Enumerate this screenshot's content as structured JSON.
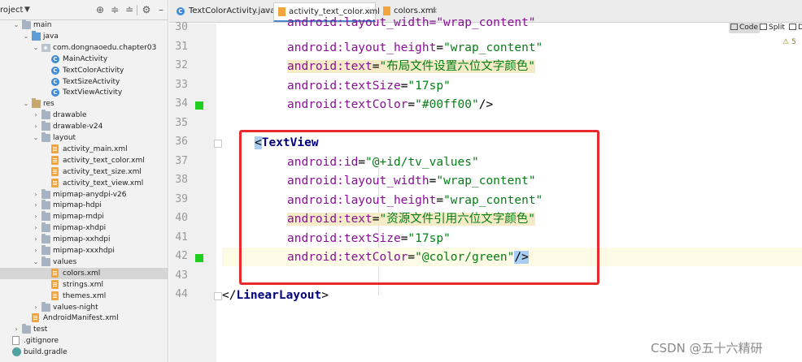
{
  "project": {
    "title": "roject",
    "tree": [
      {
        "label": "main",
        "icon": "folder",
        "expanded": true
      },
      {
        "label": "java",
        "icon": "java",
        "expanded": true
      },
      {
        "label": "com.dongnaoedu.chapter03",
        "icon": "package",
        "expanded": true
      },
      {
        "label": "MainActivity",
        "icon": "class"
      },
      {
        "label": "TextColorActivity",
        "icon": "class"
      },
      {
        "label": "TextSizeActivity",
        "icon": "class"
      },
      {
        "label": "TextViewActivity",
        "icon": "class"
      },
      {
        "label": "res",
        "icon": "res",
        "expanded": true
      },
      {
        "label": "drawable",
        "icon": "folder",
        "expanded": false
      },
      {
        "label": "drawable-v24",
        "icon": "folder",
        "expanded": false
      },
      {
        "label": "layout",
        "icon": "folder",
        "expanded": true
      },
      {
        "label": "activity_main.xml",
        "icon": "xml"
      },
      {
        "label": "activity_text_color.xml",
        "icon": "xml"
      },
      {
        "label": "activity_text_size.xml",
        "icon": "xml"
      },
      {
        "label": "activity_text_view.xml",
        "icon": "xml"
      },
      {
        "label": "mipmap-anydpi-v26",
        "icon": "folder",
        "expanded": false
      },
      {
        "label": "mipmap-hdpi",
        "icon": "folder",
        "expanded": false
      },
      {
        "label": "mipmap-mdpi",
        "icon": "folder",
        "expanded": false
      },
      {
        "label": "mipmap-xhdpi",
        "icon": "folder",
        "expanded": false
      },
      {
        "label": "mipmap-xxhdpi",
        "icon": "folder",
        "expanded": false
      },
      {
        "label": "mipmap-xxxhdpi",
        "icon": "folder",
        "expanded": false
      },
      {
        "label": "values",
        "icon": "folder",
        "expanded": true
      },
      {
        "label": "colors.xml",
        "icon": "xml",
        "selected": true
      },
      {
        "label": "strings.xml",
        "icon": "xml"
      },
      {
        "label": "themes.xml",
        "icon": "xml"
      },
      {
        "label": "values-night",
        "icon": "folder",
        "expanded": false
      },
      {
        "label": "AndroidManifest.xml",
        "icon": "xml"
      },
      {
        "label": "test",
        "icon": "folder",
        "expanded": false
      },
      {
        "label": ".gitignore",
        "icon": "text"
      },
      {
        "label": "build.gradle",
        "icon": "gradle"
      }
    ]
  },
  "tabs": [
    {
      "label": "TextColorActivity.java",
      "icon": "class",
      "active": false
    },
    {
      "label": "activity_text_color.xml",
      "icon": "xml",
      "active": true
    },
    {
      "label": "colors.xml",
      "icon": "xml",
      "active": false
    }
  ],
  "view_modes": {
    "code": "Code",
    "split": "Split",
    "design": "D"
  },
  "warnings": {
    "count": "5"
  },
  "editor": {
    "lines": [
      {
        "num": "30",
        "text": "android:layout_width=\"wrap_content\""
      },
      {
        "num": "31",
        "attr": "android:layout_height",
        "value": "\"wrap_content\""
      },
      {
        "num": "32",
        "attr": "android:text",
        "value": "\"布局文件设置六位文字颜色\""
      },
      {
        "num": "33",
        "attr": "android:textSize",
        "value": "\"17sp\""
      },
      {
        "num": "34",
        "attr": "android:textColor",
        "value": "\"#00ff00\"",
        "tail": "/>"
      },
      {
        "num": "35"
      },
      {
        "num": "36",
        "tag_open": "<",
        "tag": "TextView"
      },
      {
        "num": "37",
        "attr": "android:id",
        "value": "\"@+id/tv_values\""
      },
      {
        "num": "38",
        "attr": "android:layout_width",
        "value": "\"wrap_content\""
      },
      {
        "num": "39",
        "attr": "android:layout_height",
        "value": "\"wrap_content\""
      },
      {
        "num": "40",
        "attr": "android:text",
        "value": "\"资源文件引用六位文字颜色\""
      },
      {
        "num": "41",
        "attr": "android:textSize",
        "value": "\"17sp\""
      },
      {
        "num": "42",
        "attr": "android:textColor",
        "value": "\"@color/green\"",
        "tail": "/>"
      },
      {
        "num": "43"
      },
      {
        "num": "44",
        "tag_open": "</",
        "tag": "LinearLayout",
        "tail": ">"
      }
    ]
  },
  "watermark": "CSDN @五十六精研",
  "colors": {
    "accent_tab": "#4a88c7",
    "annotation_box": "#e8292d",
    "change_marker": "#1fcf1f",
    "attribute": "#871094",
    "string_value": "#067d17",
    "tag": "#000080"
  }
}
